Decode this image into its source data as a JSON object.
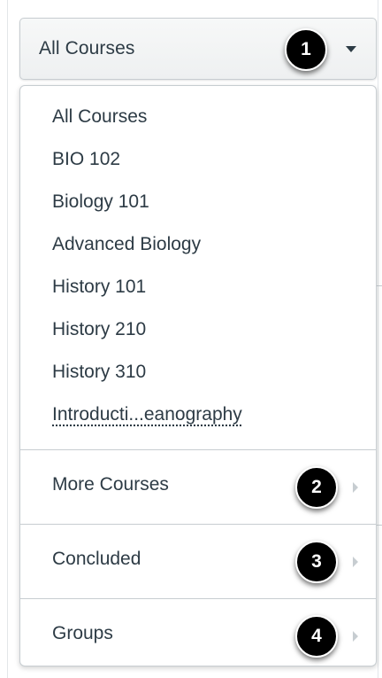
{
  "course_selector": {
    "selected_label": "All Courses",
    "badge": "1"
  },
  "menu": {
    "courses": [
      {
        "label": "All Courses"
      },
      {
        "label": "BIO 102"
      },
      {
        "label": "Biology 101"
      },
      {
        "label": "Advanced Biology"
      },
      {
        "label": "History 101"
      },
      {
        "label": "History 210"
      },
      {
        "label": "History 310"
      },
      {
        "label": "Introducti...eanography"
      }
    ],
    "sections": [
      {
        "label": "More Courses",
        "badge": "2"
      },
      {
        "label": "Concluded",
        "badge": "3"
      },
      {
        "label": "Groups",
        "badge": "4"
      }
    ]
  },
  "colors": {
    "text": "#2d3b45",
    "border": "#c7cdd1",
    "badge_bg": "#000000"
  },
  "icons": {
    "caret": "caret-down-icon",
    "chevron": "chevron-right-icon"
  }
}
